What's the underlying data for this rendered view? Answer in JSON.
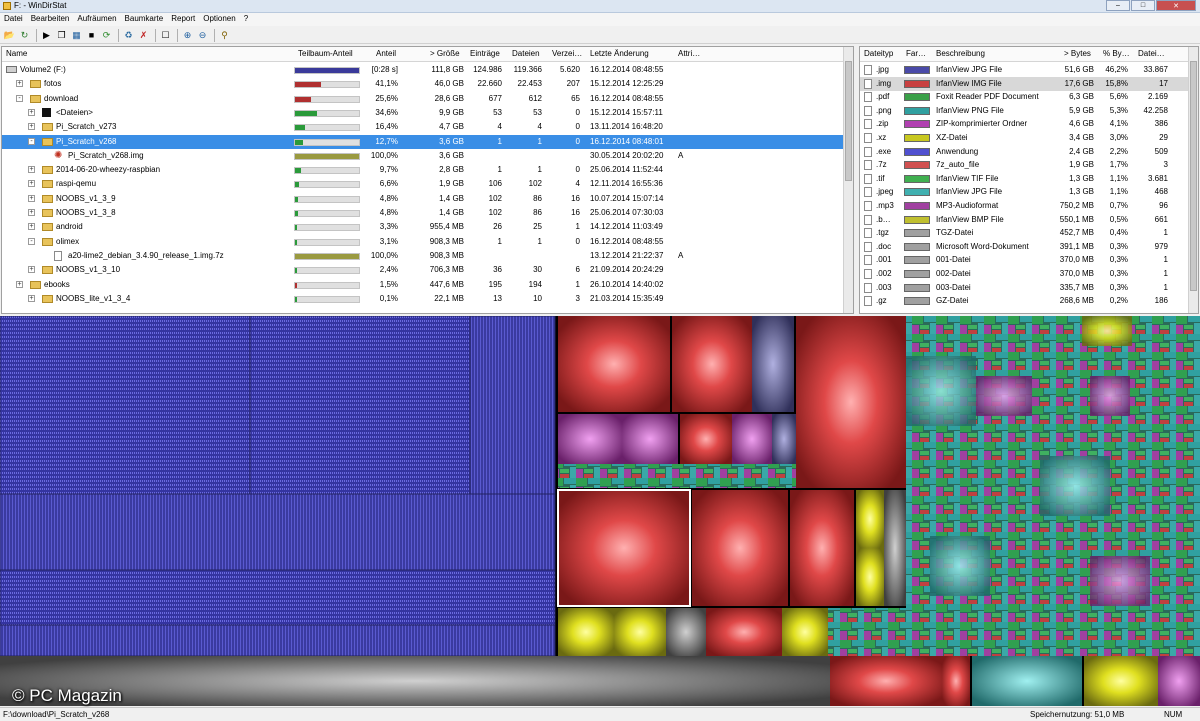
{
  "window": {
    "title": "F: - WinDirStat"
  },
  "menu": [
    "Datei",
    "Bearbeiten",
    "Aufräumen",
    "Baumkarte",
    "Report",
    "Optionen",
    "?"
  ],
  "tree": {
    "columns": [
      "Name",
      "Teilbaum-Anteil",
      "Anteil",
      "> Größe",
      "Einträge",
      "Dateien",
      "Verzei…",
      "Letzte Änderung",
      "Attri…"
    ],
    "rows": [
      {
        "name": "Volume2 (F:)",
        "share": "[0:28 s]",
        "size": "111,8 GB",
        "items": "124.986",
        "files": "119.366",
        "dirs": "5.620",
        "date": "16.12.2014  08:48:55",
        "attr": "",
        "pct": 1.0,
        "color": "#3a3a9a"
      },
      {
        "name": "fotos",
        "share": "41,1%",
        "size": "46,0 GB",
        "items": "22.660",
        "files": "22.453",
        "dirs": "207",
        "date": "15.12.2014  12:25:29",
        "attr": "",
        "pct": 0.411,
        "color": "#b03030"
      },
      {
        "name": "download",
        "share": "25,6%",
        "size": "28,6 GB",
        "items": "677",
        "files": "612",
        "dirs": "65",
        "date": "16.12.2014  08:48:55",
        "attr": "",
        "pct": 0.256,
        "color": "#b03030"
      },
      {
        "name": "<Dateien>",
        "share": "34,6%",
        "size": "9,9 GB",
        "items": "53",
        "files": "53",
        "dirs": "0",
        "date": "15.12.2014  15:57:11",
        "attr": "",
        "pct": 0.346,
        "color": "#2a9a3a"
      },
      {
        "name": "Pi_Scratch_v273",
        "share": "16,4%",
        "size": "4,7 GB",
        "items": "4",
        "files": "4",
        "dirs": "0",
        "date": "13.11.2014  16:48:20",
        "attr": "",
        "pct": 0.164,
        "color": "#2a9a3a"
      },
      {
        "name": "Pi_Scratch_v268",
        "share": "12,7%",
        "size": "3,6 GB",
        "items": "1",
        "files": "1",
        "dirs": "0",
        "date": "16.12.2014  08:48:01",
        "attr": "",
        "pct": 0.127,
        "color": "#2a9a3a"
      },
      {
        "name": "Pi_Scratch_v268.img",
        "share": "100,0%",
        "size": "3,6 GB",
        "items": "",
        "files": "",
        "dirs": "",
        "date": "30.05.2014  20:02:20",
        "attr": "A",
        "pct": 1.0,
        "color": "#9a9a40"
      },
      {
        "name": "2014-06-20-wheezy-raspbian",
        "share": "9,7%",
        "size": "2,8 GB",
        "items": "1",
        "files": "1",
        "dirs": "0",
        "date": "25.06.2014  11:52:44",
        "attr": "",
        "pct": 0.097,
        "color": "#2a9a3a"
      },
      {
        "name": "raspi-qemu",
        "share": "6,6%",
        "size": "1,9 GB",
        "items": "106",
        "files": "102",
        "dirs": "4",
        "date": "12.11.2014  16:55:36",
        "attr": "",
        "pct": 0.066,
        "color": "#2a9a3a"
      },
      {
        "name": "NOOBS_v1_3_9",
        "share": "4,8%",
        "size": "1,4 GB",
        "items": "102",
        "files": "86",
        "dirs": "16",
        "date": "10.07.2014  15:07:14",
        "attr": "",
        "pct": 0.048,
        "color": "#2a9a3a"
      },
      {
        "name": "NOOBS_v1_3_8",
        "share": "4,8%",
        "size": "1,4 GB",
        "items": "102",
        "files": "86",
        "dirs": "16",
        "date": "25.06.2014  07:30:03",
        "attr": "",
        "pct": 0.048,
        "color": "#2a9a3a"
      },
      {
        "name": "android",
        "share": "3,3%",
        "size": "955,4 MB",
        "items": "26",
        "files": "25",
        "dirs": "1",
        "date": "14.12.2014  11:03:49",
        "attr": "",
        "pct": 0.033,
        "color": "#2a9a3a"
      },
      {
        "name": "olimex",
        "share": "3,1%",
        "size": "908,3 MB",
        "items": "1",
        "files": "1",
        "dirs": "0",
        "date": "16.12.2014  08:48:55",
        "attr": "",
        "pct": 0.031,
        "color": "#2a9a3a"
      },
      {
        "name": "a20-lime2_debian_3.4.90_release_1.img.7z",
        "share": "100,0%",
        "size": "908,3 MB",
        "items": "",
        "files": "",
        "dirs": "",
        "date": "13.12.2014  21:22:37",
        "attr": "A",
        "pct": 1.0,
        "color": "#9a9a40"
      },
      {
        "name": "NOOBS_v1_3_10",
        "share": "2,4%",
        "size": "706,3 MB",
        "items": "36",
        "files": "30",
        "dirs": "6",
        "date": "21.09.2014  20:24:29",
        "attr": "",
        "pct": 0.024,
        "color": "#2a9a3a"
      },
      {
        "name": "ebooks",
        "share": "1,5%",
        "size": "447,6 MB",
        "items": "195",
        "files": "194",
        "dirs": "1",
        "date": "26.10.2014  14:40:02",
        "attr": "",
        "pct": 0.015,
        "color": "#b03030"
      },
      {
        "name": "NOOBS_lite_v1_3_4",
        "share": "0,1%",
        "size": "22,1 MB",
        "items": "13",
        "files": "10",
        "dirs": "3",
        "date": "21.03.2014  15:35:49",
        "attr": "",
        "pct": 0.001,
        "color": "#2a9a3a"
      }
    ]
  },
  "types": {
    "columns": [
      "Dateityp",
      "Far…",
      "Beschreibung",
      "> Bytes",
      "% By…",
      "Datei…"
    ],
    "rows": [
      {
        "ext": ".jpg",
        "desc": "IrfanView JPG File",
        "bytes": "51,6 GB",
        "pct": "46,2%",
        "files": "33.867",
        "color": "#4a4aa8"
      },
      {
        "ext": ".img",
        "desc": "IrfanView IMG File",
        "bytes": "17,6 GB",
        "pct": "15,8%",
        "files": "17",
        "color": "#c84040"
      },
      {
        "ext": ".pdf",
        "desc": "Foxit Reader PDF Document",
        "bytes": "6,3 GB",
        "pct": "5,6%",
        "files": "2.169",
        "color": "#3aa048"
      },
      {
        "ext": ".png",
        "desc": "IrfanView PNG File",
        "bytes": "5,9 GB",
        "pct": "5,3%",
        "files": "42.258",
        "color": "#30a0a0"
      },
      {
        "ext": ".zip",
        "desc": "ZIP-komprimierter Ordner",
        "bytes": "4,6 GB",
        "pct": "4,1%",
        "files": "386",
        "color": "#b040b0"
      },
      {
        "ext": ".xz",
        "desc": "XZ-Datei",
        "bytes": "3,4 GB",
        "pct": "3,0%",
        "files": "29",
        "color": "#c8c820"
      },
      {
        "ext": ".exe",
        "desc": "Anwendung",
        "bytes": "2,4 GB",
        "pct": "2,2%",
        "files": "509",
        "color": "#5050d0"
      },
      {
        "ext": ".7z",
        "desc": "7z_auto_file",
        "bytes": "1,9 GB",
        "pct": "1,7%",
        "files": "3",
        "color": "#d05050"
      },
      {
        "ext": ".tif",
        "desc": "IrfanView TIF File",
        "bytes": "1,3 GB",
        "pct": "1,1%",
        "files": "3.681",
        "color": "#40b050"
      },
      {
        "ext": ".jpeg",
        "desc": "IrfanView JPG File",
        "bytes": "1,3 GB",
        "pct": "1,1%",
        "files": "468",
        "color": "#40b0b0"
      },
      {
        "ext": ".mp3",
        "desc": "MP3-Audioformat",
        "bytes": "750,2 MB",
        "pct": "0,7%",
        "files": "96",
        "color": "#a040a0"
      },
      {
        "ext": ".b…",
        "desc": "IrfanView BMP File",
        "bytes": "550,1 MB",
        "pct": "0,5%",
        "files": "661",
        "color": "#c0c030"
      },
      {
        "ext": ".tgz",
        "desc": "TGZ-Datei",
        "bytes": "452,7 MB",
        "pct": "0,4%",
        "files": "1",
        "color": "#a0a0a0"
      },
      {
        "ext": ".doc",
        "desc": "Microsoft Word-Dokument",
        "bytes": "391,1 MB",
        "pct": "0,3%",
        "files": "979",
        "color": "#a0a0a0"
      },
      {
        "ext": ".001",
        "desc": "001-Datei",
        "bytes": "370,0 MB",
        "pct": "0,3%",
        "files": "1",
        "color": "#a0a0a0"
      },
      {
        "ext": ".002",
        "desc": "002-Datei",
        "bytes": "370,0 MB",
        "pct": "0,3%",
        "files": "1",
        "color": "#a0a0a0"
      },
      {
        "ext": ".003",
        "desc": "003-Datei",
        "bytes": "335,7 MB",
        "pct": "0,3%",
        "files": "1",
        "color": "#a0a0a0"
      },
      {
        "ext": ".gz",
        "desc": "GZ-Datei",
        "bytes": "268,6 MB",
        "pct": "0,2%",
        "files": "186",
        "color": "#a0a0a0"
      }
    ]
  },
  "watermark": "© PC Magazin",
  "status": {
    "path": "F:\\download\\Pi_Scratch_v268",
    "memory": "Speichernutzung:    51,0 MB",
    "num": "NUM"
  }
}
